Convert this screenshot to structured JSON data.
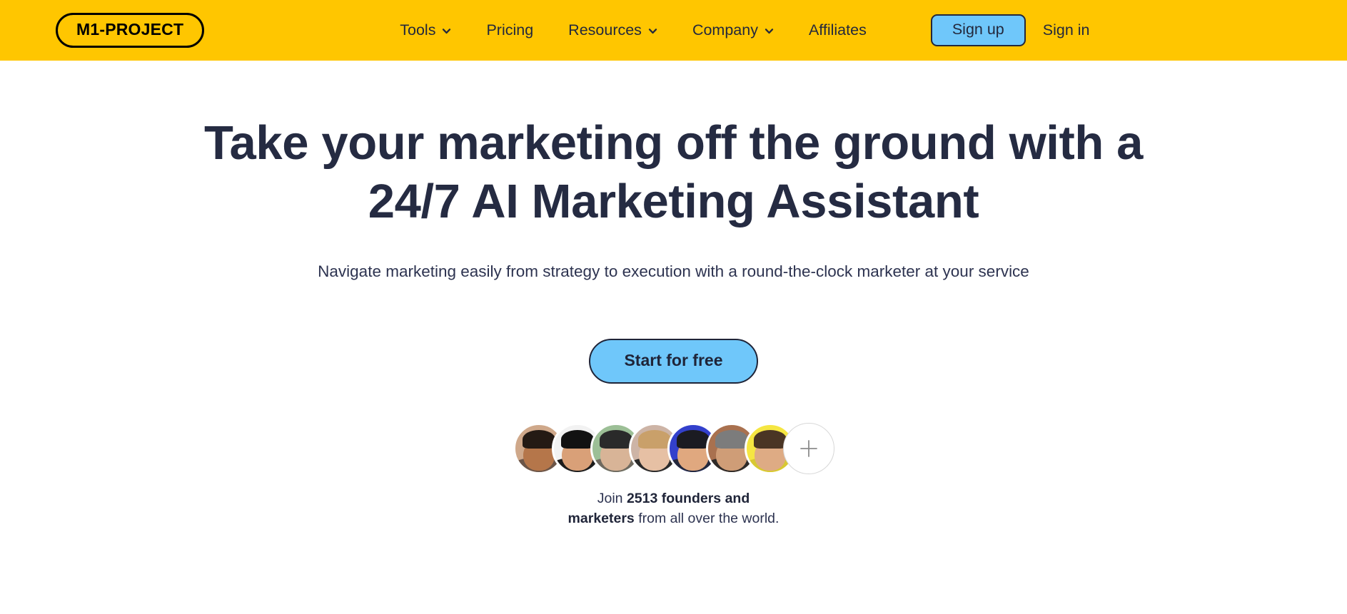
{
  "header": {
    "logo_text": "M1-PROJECT",
    "nav_items": [
      {
        "label": "Tools",
        "has_dropdown": true
      },
      {
        "label": "Pricing",
        "has_dropdown": false
      },
      {
        "label": "Resources",
        "has_dropdown": true
      },
      {
        "label": "Company",
        "has_dropdown": true
      },
      {
        "label": "Affiliates",
        "has_dropdown": false
      }
    ],
    "signup_label": "Sign up",
    "signin_label": "Sign in",
    "background_color": "#FFC600",
    "accent_color": "#6FC7FA"
  },
  "hero": {
    "headline_line1": "Take your marketing off the ground with a",
    "headline_line2": "24/7 AI Marketing Assistant",
    "subtitle": "Navigate marketing easily from strategy to execution with a round-the-clock marketer at your service",
    "cta_label": "Start for free",
    "headline_color": "#252B42"
  },
  "social_proof": {
    "prefix": "Join ",
    "count_text": "2513 founders and marketers",
    "suffix": " from all over the world.",
    "avatars": [
      {
        "name": "avatar-1",
        "bg": "#cfa88a",
        "hair": "#241a14",
        "face": "#b5764a",
        "shoulders": "#6b5548"
      },
      {
        "name": "avatar-2",
        "bg": "#f2f2f2",
        "hair": "#121212",
        "face": "#d9a078",
        "shoulders": "#1c1c1c"
      },
      {
        "name": "avatar-3",
        "bg": "#9cbf96",
        "hair": "#2a2a2a",
        "face": "#d8b497",
        "shoulders": "#6f6a60"
      },
      {
        "name": "avatar-4",
        "bg": "#cdb4a6",
        "hair": "#c9a06a",
        "face": "#e6c0a4",
        "shoulders": "#2a2a2a"
      },
      {
        "name": "avatar-5",
        "bg": "#3340cc",
        "hair": "#1b1b22",
        "face": "#e0a87f",
        "shoulders": "#23283c"
      },
      {
        "name": "avatar-6",
        "bg": "#a9714f",
        "hair": "#7c7c7c",
        "face": "#cf9d77",
        "shoulders": "#2e2a28"
      },
      {
        "name": "avatar-7",
        "bg": "#f5e642",
        "hair": "#4a3524",
        "face": "#deab84",
        "shoulders": "#d8c832"
      }
    ],
    "add_label": "+"
  }
}
